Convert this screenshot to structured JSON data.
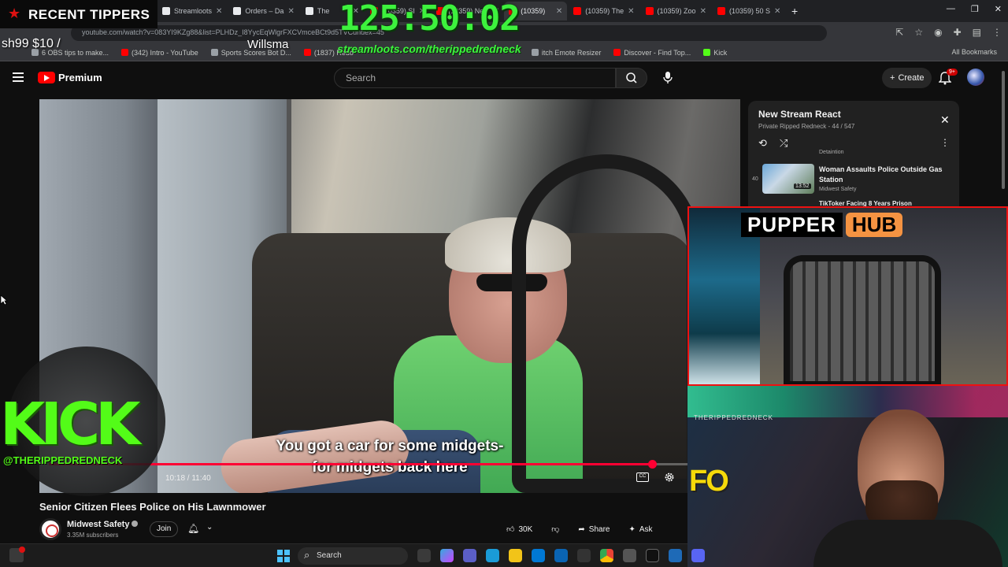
{
  "browser": {
    "tabs": [
      {
        "label": "Streamloots",
        "active": false
      },
      {
        "label": "Orders – Da",
        "active": false
      },
      {
        "label": "The",
        "active": false
      },
      {
        "label": "(10359) SI",
        "active": false
      },
      {
        "label": "(10359) New",
        "active": false
      },
      {
        "label": "(10359)",
        "active": true
      },
      {
        "label": "(10359) The",
        "active": false
      },
      {
        "label": "(10359) Zoo",
        "active": false
      },
      {
        "label": "(10359) 50 S",
        "active": false
      }
    ],
    "new_tab": "+",
    "url": "youtube.com/watch?v=083YI9KZg88&list=PLHDz_I8YycEqWlgrFXCVmceBCt9d5TVCdndex=45",
    "bookmarks": [
      {
        "label": "6 OBS tips to make..."
      },
      {
        "label": "(342) Intro - YouTube"
      },
      {
        "label": "Sports Scores Bot D..."
      },
      {
        "label": "(1837) Redo"
      },
      {
        "label": "itch Emote Resizer"
      },
      {
        "label": "Discover - Find Top..."
      },
      {
        "label": "Kick"
      }
    ],
    "all_bookmarks": "All Bookmarks"
  },
  "youtube": {
    "logo_text": "Premium",
    "search_placeholder": "Search",
    "create_label": "Create",
    "notifications_badge": "9+",
    "video": {
      "subtitle_line1": "You got a car for some midgets-",
      "subtitle_line2": "for midgets back here",
      "time": "10:18 / 11:40",
      "progress": 0.884,
      "title": "Senior Citizen Flees Police on His Lawnmower"
    },
    "channel": {
      "name": "Midwest Safety",
      "subscribers": "3.35M subscribers",
      "join_label": "Join"
    },
    "actions": {
      "likes": "30K",
      "share": "Share",
      "ask": "Ask"
    },
    "playlist": {
      "title": "New Stream React",
      "subtitle": "Private Ripped Redneck - 44 / 547",
      "prev_channel": "Detaintion",
      "item": {
        "index": "40",
        "title": "Woman Assaults Police Outside Gas Station",
        "duration": "13:52",
        "channel": "Midwest Safety"
      },
      "next_title": "TikToker Facing 8 Years Prison"
    }
  },
  "overlay": {
    "tippers_label": "RECENT TIPPERS",
    "tipper_name": "sh99 $10 /",
    "tipper_amount": "Willsma",
    "timer": "125:50:02",
    "stream_url": "streamloots.com/therippedredneck",
    "kick_text": "KICK",
    "kick_handle": "@THERIPPEDREDNECK",
    "pupper_left": "PUPPER",
    "pupper_right": "HUB",
    "webcam_text": "FO",
    "webcam_banner": "THERIPPEDREDNECK"
  },
  "taskbar": {
    "search_label": "Search"
  },
  "colors": {
    "yt_red": "#ff0000",
    "kick_green": "#53fc18",
    "timer_green": "#3df23d",
    "pupper_orange": "#f59342"
  }
}
